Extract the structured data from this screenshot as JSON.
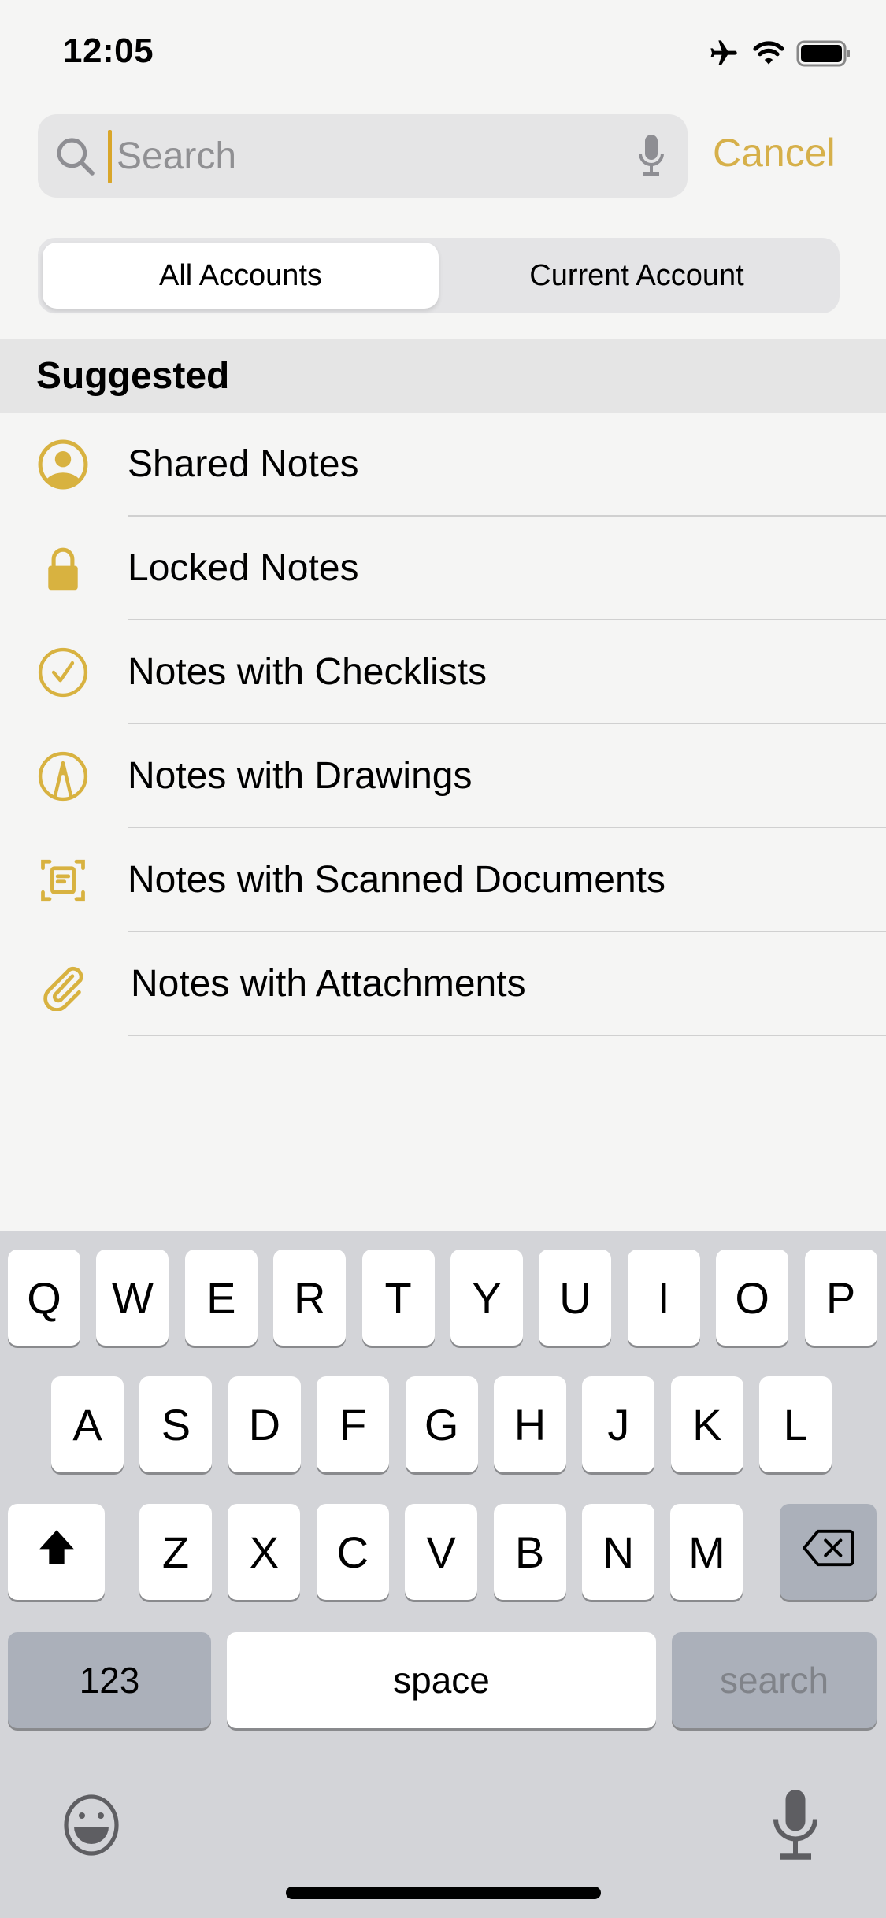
{
  "status_bar": {
    "time": "12:05",
    "icons": [
      "airplane-icon",
      "wifi-icon",
      "battery-icon"
    ]
  },
  "search": {
    "placeholder": "Search",
    "value": "",
    "cancel_label": "Cancel"
  },
  "scope": {
    "options": [
      "All Accounts",
      "Current Account"
    ],
    "selected": "All Accounts"
  },
  "suggested": {
    "header": "Suggested",
    "items": [
      {
        "label": "Shared Notes",
        "icon": "person-circle-icon"
      },
      {
        "label": "Locked Notes",
        "icon": "lock-icon"
      },
      {
        "label": "Notes with Checklists",
        "icon": "checkmark-circle-icon"
      },
      {
        "label": "Notes with Drawings",
        "icon": "pencil-tip-circle-icon"
      },
      {
        "label": "Notes with Scanned Documents",
        "icon": "doc-viewfinder-icon"
      },
      {
        "label": "Notes with Attachments",
        "icon": "paperclip-icon"
      }
    ]
  },
  "keyboard": {
    "row1": [
      "Q",
      "W",
      "E",
      "R",
      "T",
      "Y",
      "U",
      "I",
      "O",
      "P"
    ],
    "row2": [
      "A",
      "S",
      "D",
      "F",
      "G",
      "H",
      "J",
      "K",
      "L"
    ],
    "row3": [
      "Z",
      "X",
      "C",
      "V",
      "B",
      "N",
      "M"
    ],
    "numbers_label": "123",
    "space_label": "space",
    "return_label": "search"
  },
  "colors": {
    "accent": "#d6b04a",
    "icon_gold": "#d8b240",
    "keyboard_bg": "#d3d4d8"
  }
}
